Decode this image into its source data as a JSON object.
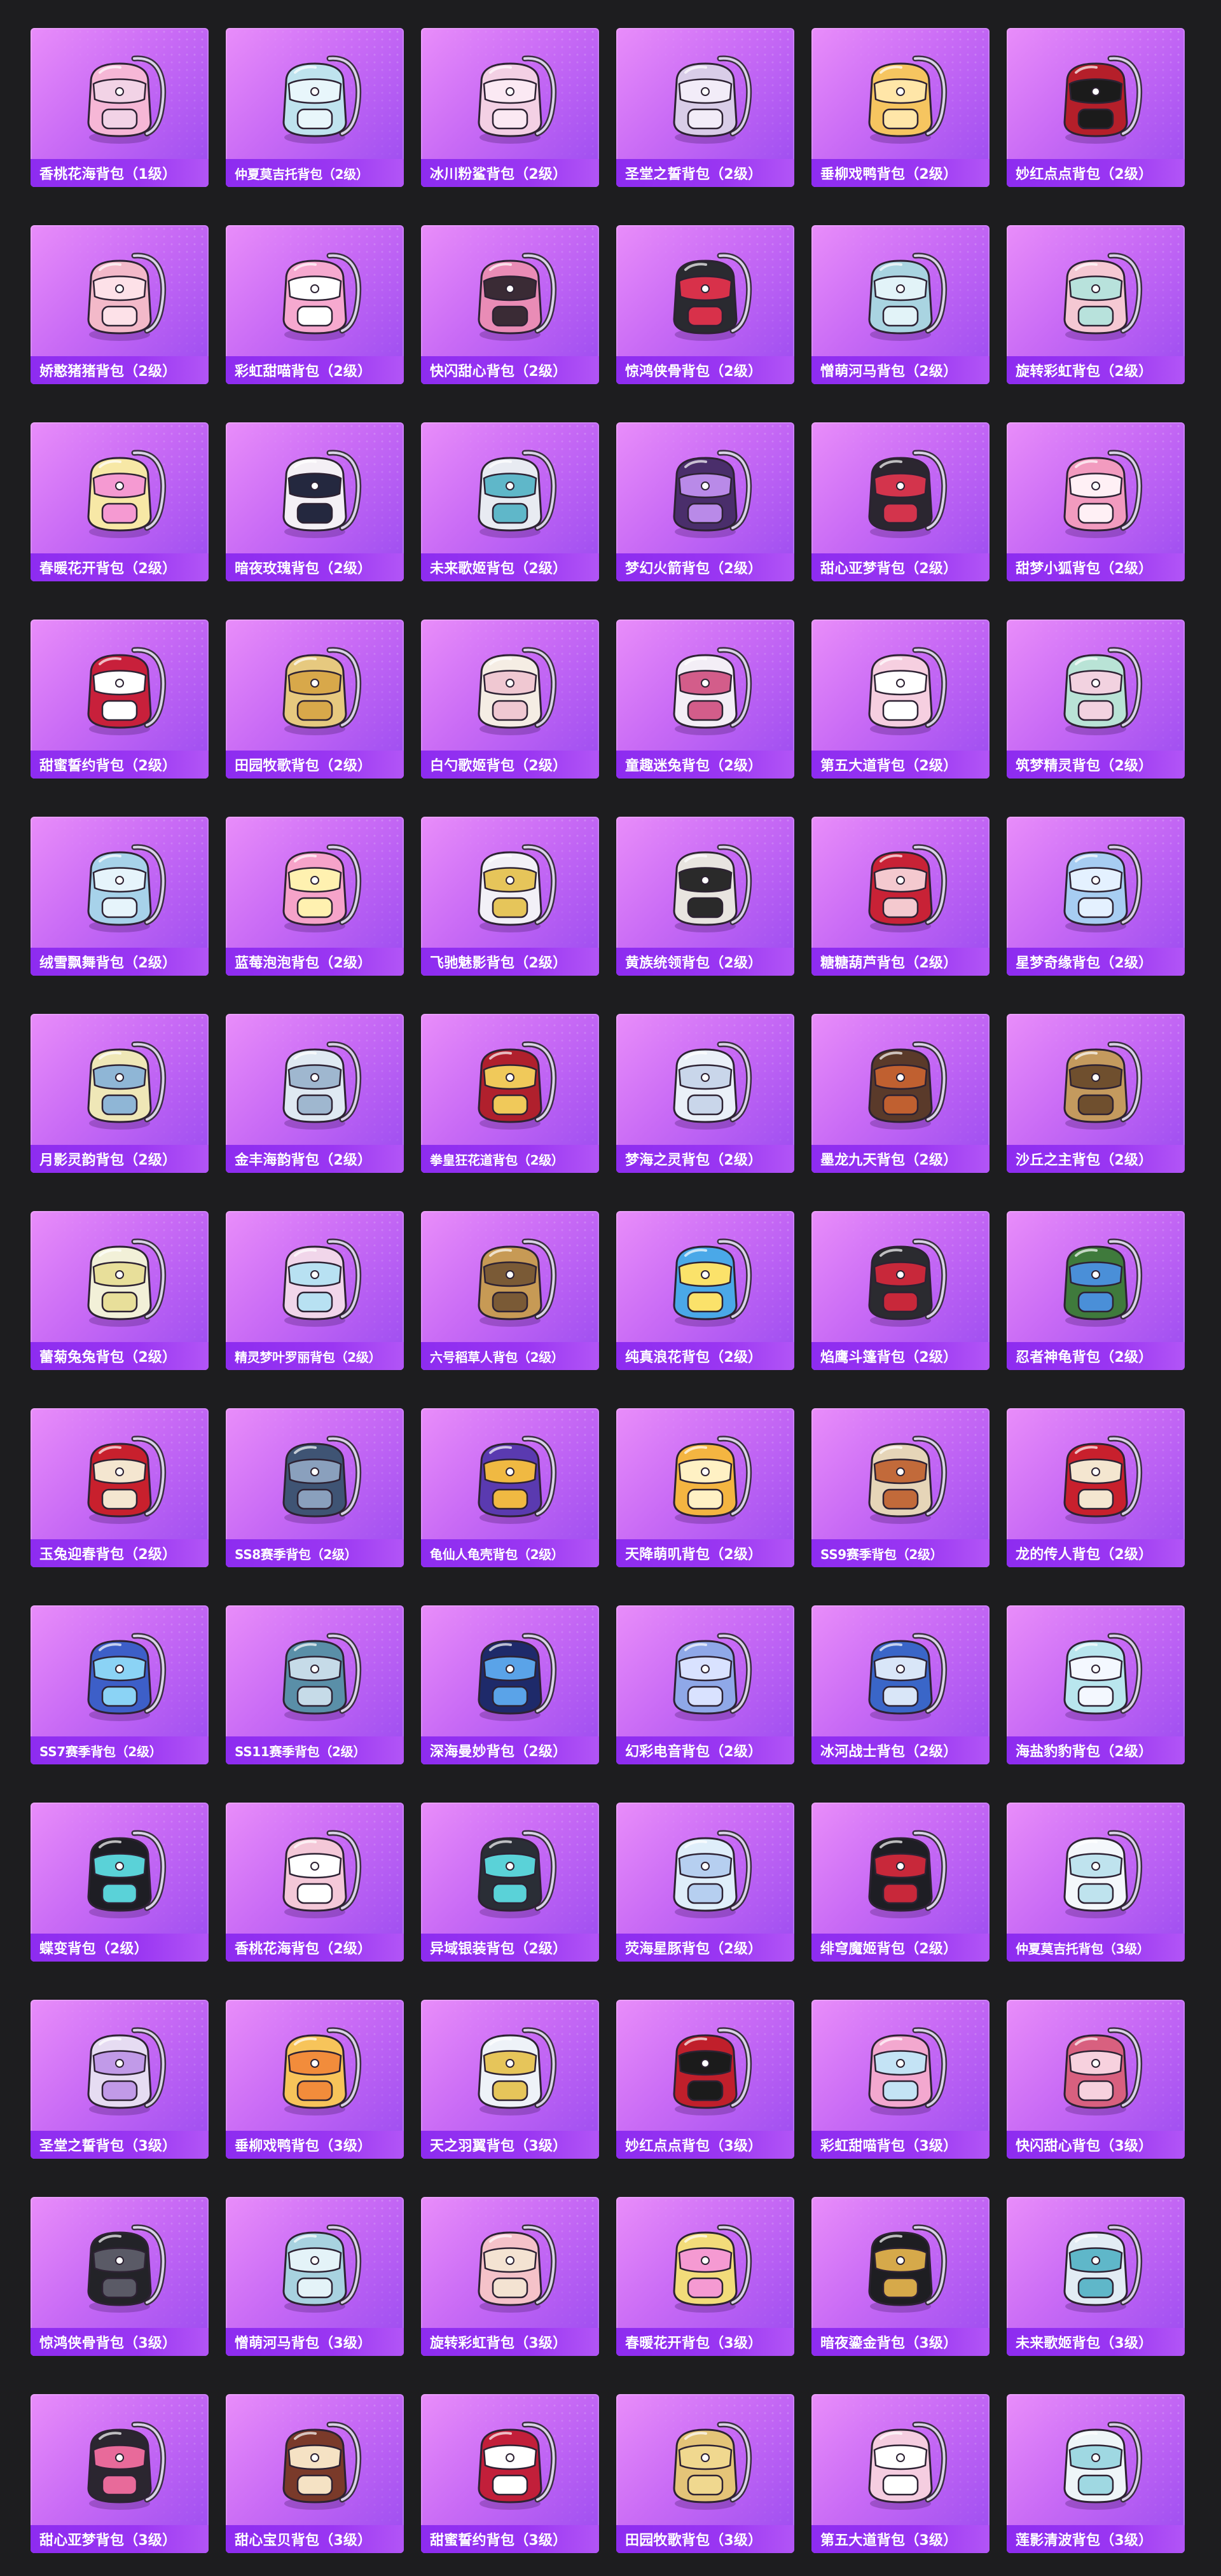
{
  "items": [
    {
      "name": "香桃花海背包（1级）",
      "icon": "backpack-icon",
      "color": "#f6b7d6",
      "accent": "#f2d3e6"
    },
    {
      "name": "仲夏莫吉托背包（2级）",
      "icon": "backpack-icon",
      "color": "#bfe3ee",
      "accent": "#e8f6fb"
    },
    {
      "name": "冰川粉鲨背包（2级）",
      "icon": "backpack-icon",
      "color": "#f3d0e4",
      "accent": "#fbe9f3"
    },
    {
      "name": "圣堂之誓背包（2级）",
      "icon": "backpack-icon",
      "color": "#d9cde8",
      "accent": "#f2ecf8"
    },
    {
      "name": "垂柳戏鸭背包（2级）",
      "icon": "backpack-icon",
      "color": "#f6c560",
      "accent": "#ffe6a8"
    },
    {
      "name": "妙红点点背包（2级）",
      "icon": "backpack-icon",
      "color": "#b51f2a",
      "accent": "#1b1b1b"
    },
    {
      "name": "娇憨猪猪背包（2级）",
      "icon": "backpack-icon",
      "color": "#f3b9c9",
      "accent": "#fde1e8"
    },
    {
      "name": "彩虹甜喵背包（2级）",
      "icon": "backpack-icon",
      "color": "#f6a9cf",
      "accent": "#ffffff"
    },
    {
      "name": "快闪甜心背包（2级）",
      "icon": "backpack-icon",
      "color": "#e98cb6",
      "accent": "#3a2b35"
    },
    {
      "name": "惊鸿侠骨背包（2级）",
      "icon": "backpack-icon",
      "color": "#2a2a30",
      "accent": "#d8314a"
    },
    {
      "name": "憎萌河马背包（2级）",
      "icon": "backpack-icon",
      "color": "#a9d4e1",
      "accent": "#e2f3f8"
    },
    {
      "name": "旋转彩虹背包（2级）",
      "icon": "backpack-icon",
      "color": "#f5c8d3",
      "accent": "#b8e2dc"
    },
    {
      "name": "春暖花开背包（2级）",
      "icon": "backpack-icon",
      "color": "#f7e8a6",
      "accent": "#f59ad2"
    },
    {
      "name": "暗夜玫瑰背包（2级）",
      "icon": "backpack-icon",
      "color": "#f4f0f5",
      "accent": "#24283f"
    },
    {
      "name": "未来歌姬背包（2级）",
      "icon": "backpack-icon",
      "color": "#e8ebf2",
      "accent": "#5fb7c9"
    },
    {
      "name": "梦幻火箭背包（2级）",
      "icon": "backpack-icon",
      "color": "#4a2e6b",
      "accent": "#b98ae8"
    },
    {
      "name": "甜心亚梦背包（2级）",
      "icon": "backpack-icon",
      "color": "#2b2630",
      "accent": "#d3344c"
    },
    {
      "name": "甜梦小狐背包（2级）",
      "icon": "backpack-icon",
      "color": "#f29bbf",
      "accent": "#fff0f5"
    },
    {
      "name": "甜蜜誓约背包（2级）",
      "icon": "backpack-icon",
      "color": "#c8203b",
      "accent": "#ffffff"
    },
    {
      "name": "田园牧歌背包（2级）",
      "icon": "backpack-icon",
      "color": "#e6c97f",
      "accent": "#d8a84a"
    },
    {
      "name": "白勺歌姬背包（2级）",
      "icon": "backpack-icon",
      "color": "#f5ede4",
      "accent": "#f0c8d2"
    },
    {
      "name": "童趣迷兔背包（2级）",
      "icon": "backpack-icon",
      "color": "#f3eef6",
      "accent": "#d35d8a"
    },
    {
      "name": "第五大道背包（2级）",
      "icon": "backpack-icon",
      "color": "#f6cfe0",
      "accent": "#ffffff"
    },
    {
      "name": "筑梦精灵背包（2级）",
      "icon": "backpack-icon",
      "color": "#b9e3d6",
      "accent": "#f2d2e0"
    },
    {
      "name": "绒雪飘舞背包（2级）",
      "icon": "backpack-icon",
      "color": "#a7d2ea",
      "accent": "#e6f4fb"
    },
    {
      "name": "蓝莓泡泡背包（2级）",
      "icon": "backpack-icon",
      "color": "#f6a3c9",
      "accent": "#fff1b0"
    },
    {
      "name": "飞驰魅影背包（2级）",
      "icon": "backpack-icon",
      "color": "#f2f0f7",
      "accent": "#e6c55a"
    },
    {
      "name": "黄族统领背包（2级）",
      "icon": "backpack-icon",
      "color": "#e8e4e0",
      "accent": "#2a2a2a"
    },
    {
      "name": "糖糖葫芦背包（2级）",
      "icon": "backpack-icon",
      "color": "#c82236",
      "accent": "#f4c9cf"
    },
    {
      "name": "星梦奇缘背包（2级）",
      "icon": "backpack-icon",
      "color": "#a7cdf2",
      "accent": "#e4f1ff"
    },
    {
      "name": "月影灵韵背包（2级）",
      "icon": "backpack-icon",
      "color": "#efe7b7",
      "accent": "#8fb6d6"
    },
    {
      "name": "金丰海韵背包（2级）",
      "icon": "backpack-icon",
      "color": "#dfe9f2",
      "accent": "#9fb7cf"
    },
    {
      "name": "拳皇狂花道背包（2级）",
      "icon": "backpack-icon",
      "color": "#b0202d",
      "accent": "#f0c95a"
    },
    {
      "name": "梦海之灵背包（2级）",
      "icon": "backpack-icon",
      "color": "#eaf0f8",
      "accent": "#c9d6ea"
    },
    {
      "name": "墨龙九天背包（2级）",
      "icon": "backpack-icon",
      "color": "#5a3a2a",
      "accent": "#c06030"
    },
    {
      "name": "沙丘之主背包（2级）",
      "icon": "backpack-icon",
      "color": "#c49a5e",
      "accent": "#6f4f2e"
    },
    {
      "name": "蕾菊兔兔背包（2级）",
      "icon": "backpack-icon",
      "color": "#f2f0d8",
      "accent": "#e8df9a"
    },
    {
      "name": "精灵梦叶罗丽背包（2级）",
      "icon": "backpack-icon",
      "color": "#f1d6ea",
      "accent": "#b8e1f2"
    },
    {
      "name": "六号稻草人背包（2级）",
      "icon": "backpack-icon",
      "color": "#c79a55",
      "accent": "#7a5a36"
    },
    {
      "name": "纯真浪花背包（2级）",
      "icon": "backpack-icon",
      "color": "#4aa8e8",
      "accent": "#fbe26a"
    },
    {
      "name": "焰鹰斗篷背包（2级）",
      "icon": "backpack-icon",
      "color": "#2b2b30",
      "accent": "#c8283a"
    },
    {
      "name": "忍者神龟背包（2级）",
      "icon": "backpack-icon",
      "color": "#3f7a3c",
      "accent": "#4a8fd8"
    },
    {
      "name": "玉兔迎春背包（2级）",
      "icon": "backpack-icon",
      "color": "#c8202d",
      "accent": "#f4e6d0"
    },
    {
      "name": "SS8赛季背包（2级）",
      "icon": "backpack-icon",
      "color": "#3f5474",
      "accent": "#8aa0bd"
    },
    {
      "name": "龟仙人龟壳背包（2级）",
      "icon": "backpack-icon",
      "color": "#5a3ab0",
      "accent": "#f0b942"
    },
    {
      "name": "天降萌叽背包（2级）",
      "icon": "backpack-icon",
      "color": "#f4b541",
      "accent": "#fff1c4"
    },
    {
      "name": "SS9赛季背包（2级）",
      "icon": "backpack-icon",
      "color": "#e6d5b8",
      "accent": "#c26a3a"
    },
    {
      "name": "龙的传人背包（2级）",
      "icon": "backpack-icon",
      "color": "#c8202d",
      "accent": "#f4e6d0"
    },
    {
      "name": "SS7赛季背包（2级）",
      "icon": "backpack-icon",
      "color": "#3d5fc8",
      "accent": "#8bd3f5"
    },
    {
      "name": "SS11赛季背包（2级）",
      "icon": "backpack-icon",
      "color": "#5a8fa8",
      "accent": "#c6dbe8"
    },
    {
      "name": "深海曼妙背包（2级）",
      "icon": "backpack-icon",
      "color": "#1e2a6a",
      "accent": "#5aa3e8"
    },
    {
      "name": "幻彩电音背包（2级）",
      "icon": "backpack-icon",
      "color": "#8fa8e8",
      "accent": "#d9e2ff"
    },
    {
      "name": "冰河战士背包（2级）",
      "icon": "backpack-icon",
      "color": "#3a66c8",
      "accent": "#d9e6f8"
    },
    {
      "name": "海盐豹豹背包（2级）",
      "icon": "backpack-icon",
      "color": "#b9e6ee",
      "accent": "#f4f8ff"
    },
    {
      "name": "蝶变背包（2级）",
      "icon": "backpack-icon",
      "color": "#1e1e24",
      "accent": "#5ad2d8"
    },
    {
      "name": "香桃花海背包（2级）",
      "icon": "backpack-icon",
      "color": "#f4c8d8",
      "accent": "#ffffff"
    },
    {
      "name": "异域银装背包（2级）",
      "icon": "backpack-icon",
      "color": "#2a2e36",
      "accent": "#5ad2d8"
    },
    {
      "name": "荧海星豚背包（2级）",
      "icon": "backpack-icon",
      "color": "#dfeefa",
      "accent": "#b6cff0"
    },
    {
      "name": "绯穹魔姬背包（2级）",
      "icon": "backpack-icon",
      "color": "#1e1e24",
      "accent": "#c8283a"
    },
    {
      "name": "仲夏莫吉托背包（3级）",
      "icon": "backpack-icon",
      "color": "#f4f7fb",
      "accent": "#bfe3ee"
    },
    {
      "name": "圣堂之誓背包（3级）",
      "icon": "backpack-icon",
      "color": "#e6dcf2",
      "accent": "#c19ae8"
    },
    {
      "name": "垂柳戏鸭背包（3级）",
      "icon": "backpack-icon",
      "color": "#f7c45a",
      "accent": "#f28c3b"
    },
    {
      "name": "天之羽翼背包（3级）",
      "icon": "backpack-icon",
      "color": "#eef2f8",
      "accent": "#e6c55a"
    },
    {
      "name": "妙红点点背包（3级）",
      "icon": "backpack-icon",
      "color": "#c01f2b",
      "accent": "#1b1b1b"
    },
    {
      "name": "彩虹甜喵背包（3级）",
      "icon": "backpack-icon",
      "color": "#f3a8cf",
      "accent": "#c4e3f5"
    },
    {
      "name": "快闪甜心背包（3级）",
      "icon": "backpack-icon",
      "color": "#d8607f",
      "accent": "#f7d1de"
    },
    {
      "name": "惊鸿侠骨背包（3级）",
      "icon": "backpack-icon",
      "color": "#232328",
      "accent": "#5a5a66"
    },
    {
      "name": "憎萌河马背包（3级）",
      "icon": "backpack-icon",
      "color": "#a8d2e0",
      "accent": "#e4f3f8"
    },
    {
      "name": "旋转彩虹背包（3级）",
      "icon": "backpack-icon",
      "color": "#f5c2c9",
      "accent": "#f4e3d2"
    },
    {
      "name": "春暖花开背包（3级）",
      "icon": "backpack-icon",
      "color": "#f2dc7a",
      "accent": "#f59ad2"
    },
    {
      "name": "暗夜鎏金背包（3级）",
      "icon": "backpack-icon",
      "color": "#1e1e22",
      "accent": "#d6a94a"
    },
    {
      "name": "未来歌姬背包（3级）",
      "icon": "backpack-icon",
      "color": "#e2ecf4",
      "accent": "#5fb7c9"
    },
    {
      "name": "甜心亚梦背包（3级）",
      "icon": "backpack-icon",
      "color": "#2b2630",
      "accent": "#e86a9a"
    },
    {
      "name": "甜心宝贝背包（3级）",
      "icon": "backpack-icon",
      "color": "#7a3a2a",
      "accent": "#f5e2c4"
    },
    {
      "name": "甜蜜誓约背包（3级）",
      "icon": "backpack-icon",
      "color": "#c21f3a",
      "accent": "#ffffff"
    },
    {
      "name": "田园牧歌背包（3级）",
      "icon": "backpack-icon",
      "color": "#e4c478",
      "accent": "#f0d88f"
    },
    {
      "name": "第五大道背包（3级）",
      "icon": "backpack-icon",
      "color": "#f5cde0",
      "accent": "#ffffff"
    },
    {
      "name": "莲影清波背包（3级）",
      "icon": "backpack-icon",
      "color": "#eef5f8",
      "accent": "#9fd8e2"
    }
  ]
}
